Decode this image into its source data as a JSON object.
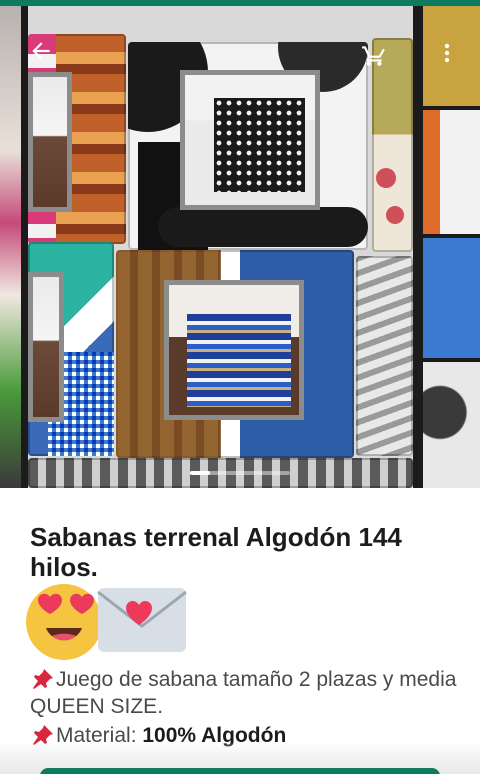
{
  "app": {
    "accent_color": "#0e7a5f"
  },
  "gallery": {
    "back_icon": "arrow-left-icon",
    "cart_icon": "shopping-cart-icon",
    "more_icon": "more-vertical-icon",
    "current_page_fraction": 0.2
  },
  "product": {
    "title": "Sabanas terrenal Algodón 144 hilos.",
    "emoji": [
      "heart-eyes-face",
      "love-letter"
    ],
    "description_line1": "Juego de sabana tamaño 2 plazas y media QUEEN SIZE.",
    "material_label": "Material:",
    "material_value": "100% Algodón",
    "pin_icon": "pushpin-icon"
  }
}
